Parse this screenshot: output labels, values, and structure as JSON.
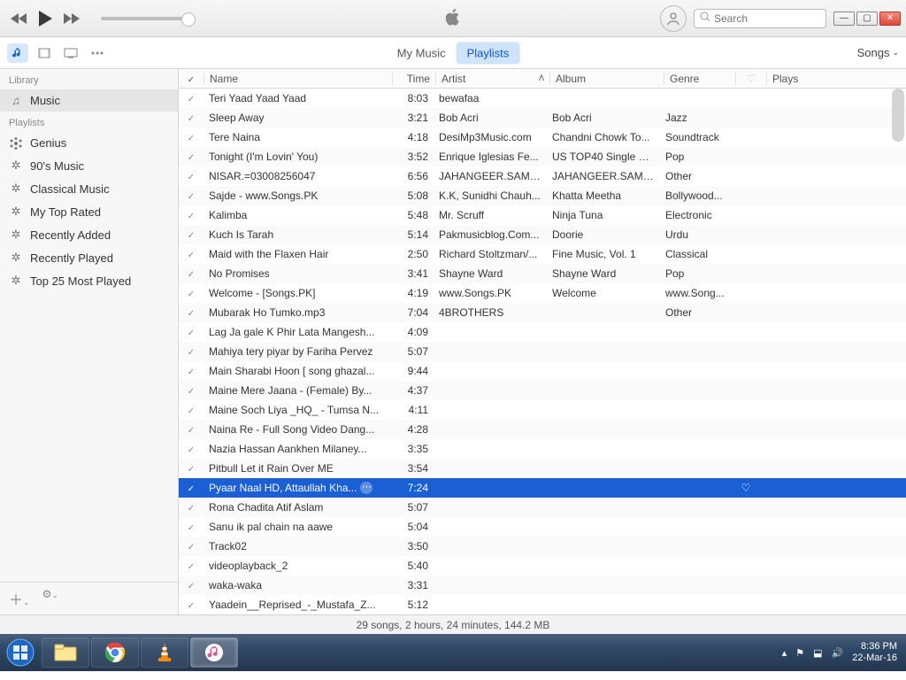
{
  "toolbar": {
    "search_placeholder": "Search"
  },
  "nav": {
    "tabs": {
      "music": "My Music",
      "playlists": "Playlists"
    },
    "right_dropdown": "Songs"
  },
  "sidebar": {
    "section_library": "Library",
    "music": "Music",
    "section_playlists": "Playlists",
    "items": [
      "Genius",
      "90's Music",
      "Classical Music",
      "My Top Rated",
      "Recently Added",
      "Recently Played",
      "Top 25 Most Played"
    ]
  },
  "columns": {
    "name": "Name",
    "time": "Time",
    "artist": "Artist",
    "album": "Album",
    "genre": "Genre",
    "plays": "Plays"
  },
  "selected_index": 20,
  "tracks": [
    {
      "name": "Teri Yaad Yaad Yaad",
      "time": "8:03",
      "artist": "bewafaa",
      "album": "",
      "genre": ""
    },
    {
      "name": "Sleep Away",
      "time": "3:21",
      "artist": "Bob Acri",
      "album": "Bob Acri",
      "genre": "Jazz"
    },
    {
      "name": "Tere Naina",
      "time": "4:18",
      "artist": "DesiMp3Music.com",
      "album": "Chandni Chowk To...",
      "genre": "Soundtrack"
    },
    {
      "name": "Tonight (I'm Lovin' You)",
      "time": "3:52",
      "artist": "Enrique Iglesias Fe...",
      "album": "US TOP40 Single C...",
      "genre": "Pop"
    },
    {
      "name": "NISAR.=03008256047",
      "time": "6:56",
      "artist": "JAHANGEER.SAMO...",
      "album": "JAHANGEER.SAMO...",
      "genre": "Other"
    },
    {
      "name": "Sajde - www.Songs.PK",
      "time": "5:08",
      "artist": "K.K, Sunidhi Chauh...",
      "album": "Khatta Meetha",
      "genre": "Bollywood..."
    },
    {
      "name": "Kalimba",
      "time": "5:48",
      "artist": "Mr. Scruff",
      "album": "Ninja Tuna",
      "genre": "Electronic"
    },
    {
      "name": "Kuch Is Tarah",
      "time": "5:14",
      "artist": "Pakmusicblog.Com...",
      "album": "Doorie",
      "genre": "Urdu"
    },
    {
      "name": "Maid with the Flaxen Hair",
      "time": "2:50",
      "artist": "Richard Stoltzman/...",
      "album": "Fine Music, Vol. 1",
      "genre": "Classical"
    },
    {
      "name": "No Promises",
      "time": "3:41",
      "artist": "Shayne Ward",
      "album": "Shayne Ward",
      "genre": "Pop"
    },
    {
      "name": "Welcome - [Songs.PK]",
      "time": "4:19",
      "artist": "www.Songs.PK",
      "album": "Welcome",
      "genre": "www.Song..."
    },
    {
      "name": "Mubarak Ho Tumko.mp3",
      "time": "7:04",
      "artist": "4BROTHERS",
      "album": "",
      "genre": "Other"
    },
    {
      "name": "Lag Ja gale K Phir  Lata Mangesh...",
      "time": "4:09",
      "artist": "",
      "album": "",
      "genre": ""
    },
    {
      "name": "Mahiya tery piyar by Fariha Pervez",
      "time": "5:07",
      "artist": "",
      "album": "",
      "genre": ""
    },
    {
      "name": "Main Sharabi Hoon [ song ghazal...",
      "time": "9:44",
      "artist": "",
      "album": "",
      "genre": ""
    },
    {
      "name": "Maine Mere Jaana - (Female) By...",
      "time": "4:37",
      "artist": "",
      "album": "",
      "genre": ""
    },
    {
      "name": "Maine Soch Liya _HQ_ - Tumsa N...",
      "time": "4:11",
      "artist": "",
      "album": "",
      "genre": ""
    },
    {
      "name": "Naina Re - Full Song Video Dang...",
      "time": "4:28",
      "artist": "",
      "album": "",
      "genre": ""
    },
    {
      "name": "Nazia Hassan  Aankhen Milaney...",
      "time": "3:35",
      "artist": "",
      "album": "",
      "genre": ""
    },
    {
      "name": "Pitbull Let it Rain Over ME",
      "time": "3:54",
      "artist": "",
      "album": "",
      "genre": ""
    },
    {
      "name": "Pyaar Naal HD, Attaullah  Kha...",
      "time": "7:24",
      "artist": "",
      "album": "",
      "genre": ""
    },
    {
      "name": "Rona Chadita Atif Aslam",
      "time": "5:07",
      "artist": "",
      "album": "",
      "genre": ""
    },
    {
      "name": "Sanu ik pal chain na aawe",
      "time": "5:04",
      "artist": "",
      "album": "",
      "genre": ""
    },
    {
      "name": "Track02",
      "time": "3:50",
      "artist": "",
      "album": "",
      "genre": ""
    },
    {
      "name": "videoplayback_2",
      "time": "5:40",
      "artist": "",
      "album": "",
      "genre": ""
    },
    {
      "name": "waka-waka",
      "time": "3:31",
      "artist": "",
      "album": "",
      "genre": ""
    },
    {
      "name": "Yaadein__Reprised_-_Mustafa_Z...",
      "time": "5:12",
      "artist": "",
      "album": "",
      "genre": ""
    }
  ],
  "status_bar": "29 songs, 2 hours, 24 minutes, 144.2 MB",
  "taskbar": {
    "time": "8:36 PM",
    "date": "22-Mar-16"
  }
}
